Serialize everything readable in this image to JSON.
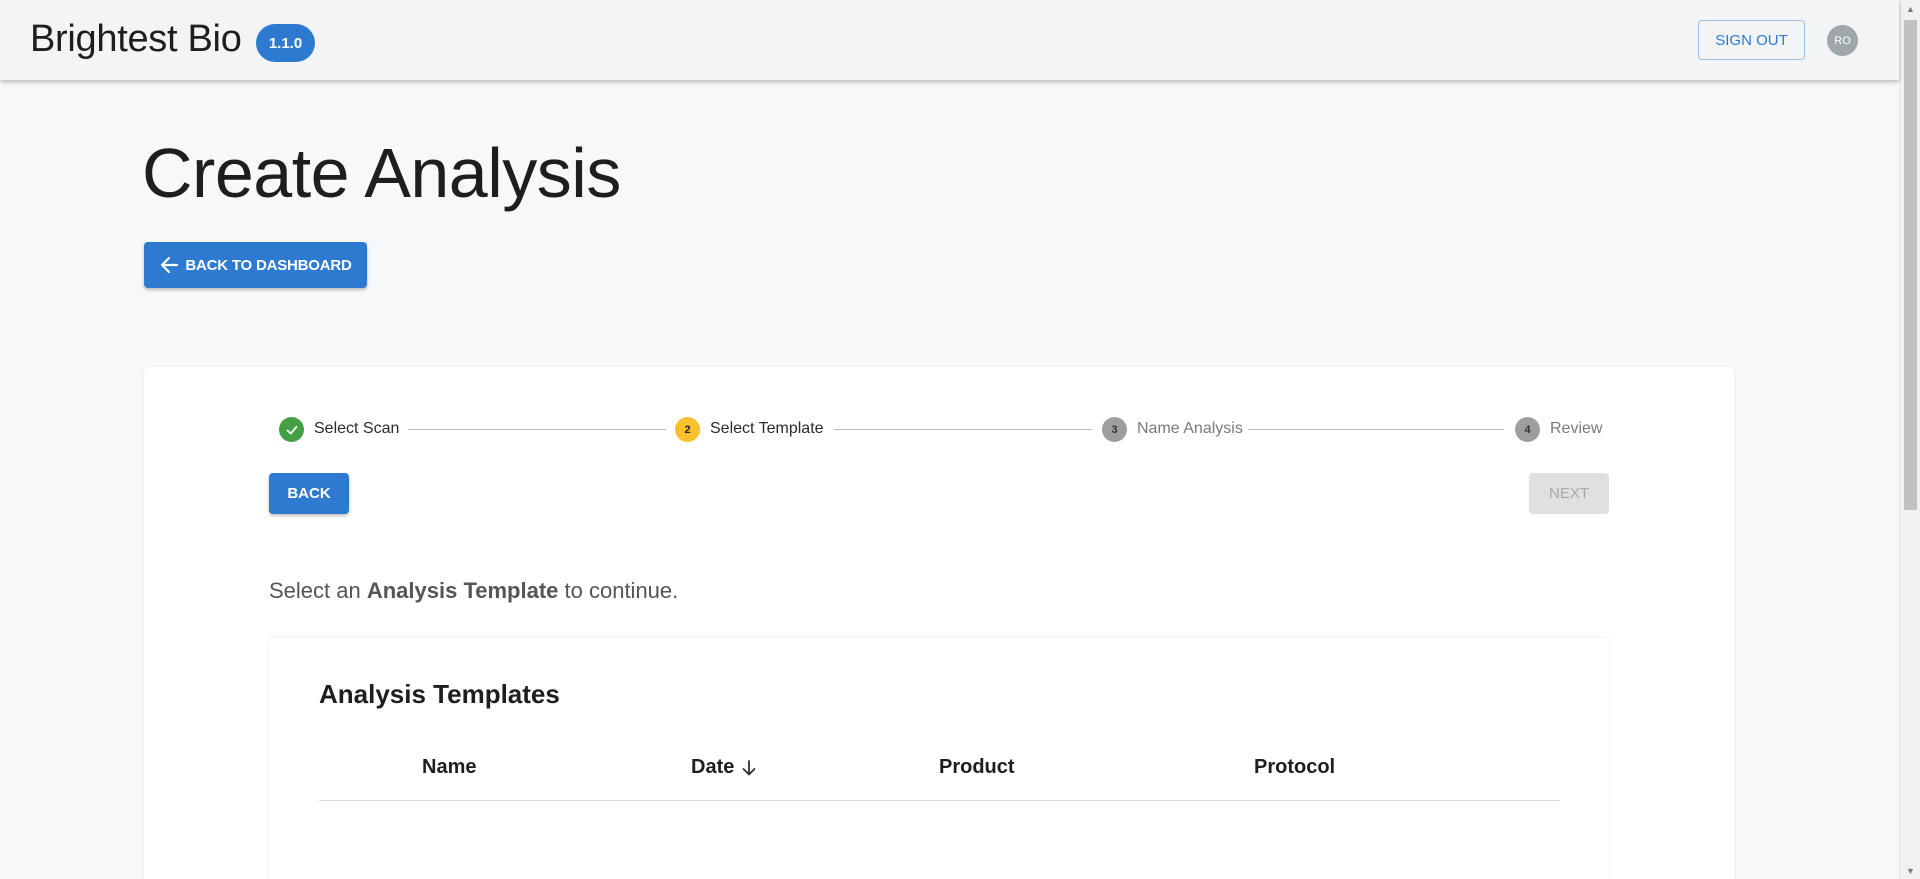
{
  "header": {
    "brand": "Brightest Bio",
    "version": "1.1.0",
    "sign_out": "SIGN OUT",
    "avatar_initials": "RO"
  },
  "page": {
    "title": "Create Analysis",
    "back_to_dashboard": "BACK TO DASHBOARD"
  },
  "stepper": {
    "steps": [
      {
        "number": "1",
        "label": "Select Scan",
        "state": "completed"
      },
      {
        "number": "2",
        "label": "Select Template",
        "state": "active"
      },
      {
        "number": "3",
        "label": "Name Analysis",
        "state": "inactive"
      },
      {
        "number": "4",
        "label": "Review",
        "state": "inactive"
      }
    ],
    "back": "BACK",
    "next": "NEXT"
  },
  "instruction": {
    "prefix": "Select an ",
    "emphasis": "Analysis Template",
    "suffix": " to continue."
  },
  "templates": {
    "title": "Analysis Templates",
    "columns": [
      "Name",
      "Date",
      "Product",
      "Protocol"
    ],
    "sort_column": "Date",
    "sort_direction": "descending",
    "rows": []
  },
  "colors": {
    "primary": "#2e7ad1",
    "completed": "#43a047",
    "active": "#fbc02d",
    "inactive": "#9e9e9e"
  }
}
